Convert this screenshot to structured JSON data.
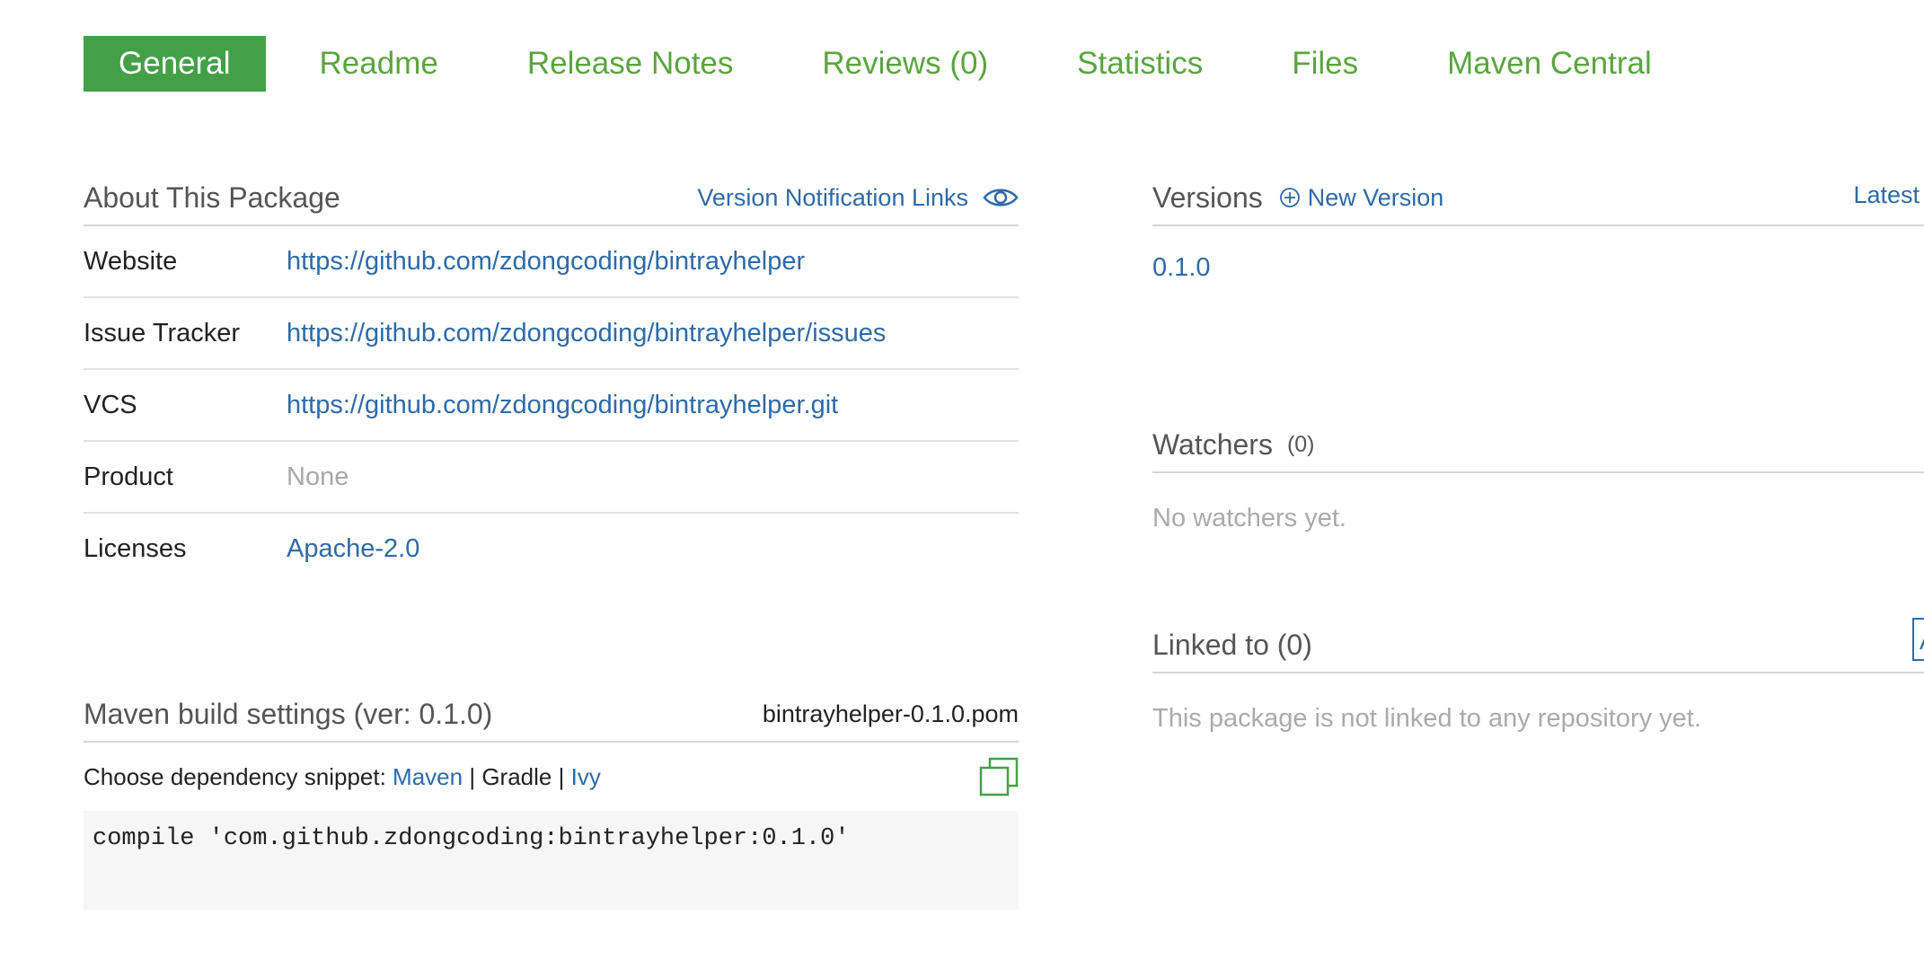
{
  "tabs": [
    "General",
    "Readme",
    "Release Notes",
    "Reviews (0)",
    "Statistics",
    "Files",
    "Maven Central"
  ],
  "about": {
    "title": "About This Package",
    "notification_link": "Version Notification Links",
    "rows": [
      {
        "label": "Website",
        "value": "https://github.com/zdongcoding/bintrayhelper"
      },
      {
        "label": "Issue Tracker",
        "value": "https://github.com/zdongcoding/bintrayhelper/issues"
      },
      {
        "label": "VCS",
        "value": "https://github.com/zdongcoding/bintrayhelper.git"
      },
      {
        "label": "Product",
        "value": "None"
      },
      {
        "label": "Licenses",
        "value": "Apache-2.0"
      }
    ]
  },
  "maven": {
    "title": "Maven build settings (ver: 0.1.0)",
    "file": "bintrayhelper-0.1.0.pom",
    "choose_label": "Choose dependency snippet:",
    "maven_link": "Maven",
    "sep1": "|",
    "gradle_label": "Gradle",
    "sep2": "|",
    "ivy_link": "Ivy",
    "code": "compile 'com.github.zdongcoding:bintrayhelper:0.1.0'"
  },
  "versions": {
    "title": "Versions",
    "new_version": "New Version",
    "latest": "Latest",
    "items": [
      "0.1.0"
    ]
  },
  "watchers": {
    "title": "Watchers",
    "count": "(0)",
    "empty": "No watchers yet."
  },
  "linked": {
    "title": "Linked to (0)",
    "empty": "This package is not linked to any repository yet.",
    "add_label": "A"
  },
  "colors": {
    "accent_green": "#43a047",
    "tab_green": "#5aa53f",
    "link_blue": "#2e6aa8"
  }
}
